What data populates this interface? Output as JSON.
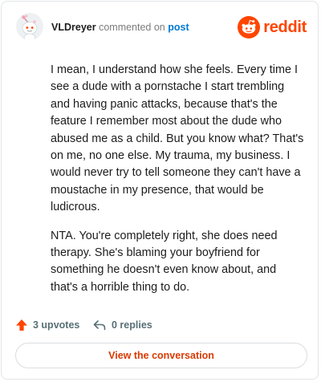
{
  "comment": {
    "username": "VLDreyer",
    "action": "commented on",
    "target_link": "post",
    "paragraphs": [
      "I mean, I understand how she feels. Every time I see a dude with a pornstache I start trembling and having panic attacks, because that's the feature I remember most about the dude who abused me as a child. But you know what? That's on me, no one else. My trauma, my business. I would never try to tell someone they can't have a moustache in my presence, that would be ludicrous.",
      "NTA. You're completely right, she does need therapy. She's blaming your boyfriend for something he doesn't even know about, and that's a horrible thing to do."
    ],
    "upvotes_label": "3 upvotes",
    "replies_label": "0 replies",
    "cta_label": "View the conversation"
  },
  "brand": {
    "wordmark": "reddit",
    "accent": "#ff4500",
    "link_color": "#0079d3",
    "cta_color": "#d93a00"
  },
  "icons": {
    "avatar": "snoo-avatar",
    "brand": "reddit-logo-icon",
    "upvote": "upvote-arrow-icon",
    "reply": "reply-arrow-icon"
  }
}
